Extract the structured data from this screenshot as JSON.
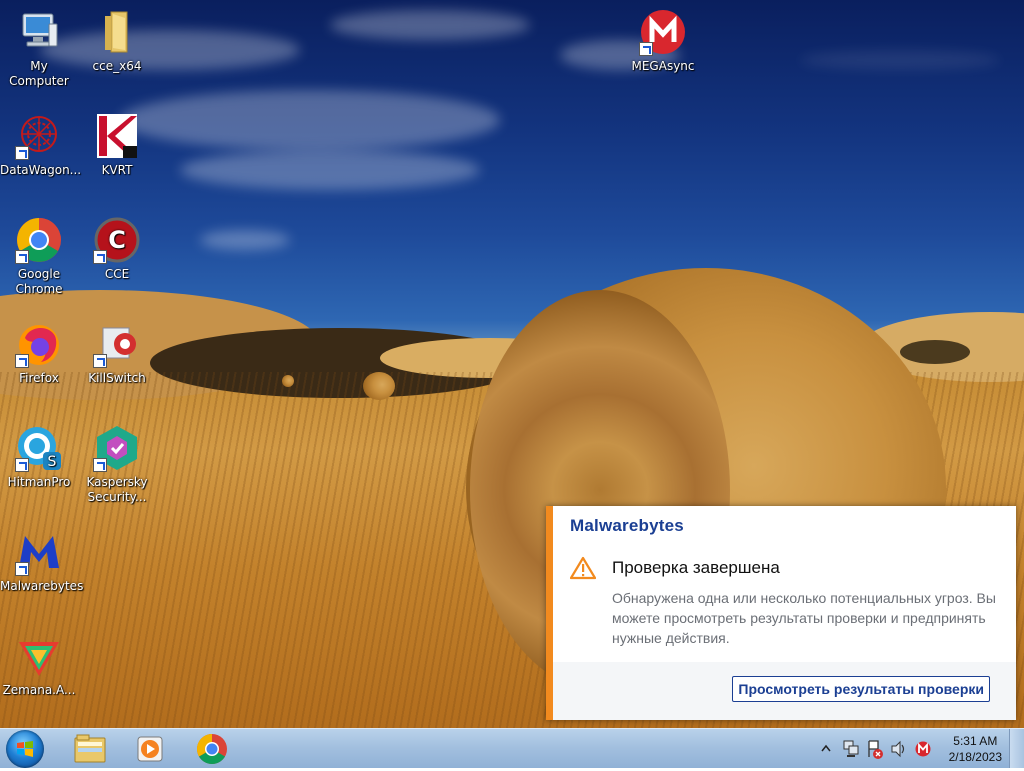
{
  "desktop": {
    "icons": [
      {
        "label": "My Computer",
        "icon": "computer-icon"
      },
      {
        "label": "cce_x64",
        "icon": "folder-icon"
      },
      {
        "label": "MEGAsync",
        "icon": "megasync-icon"
      },
      {
        "label": "DataWagon...",
        "icon": "datawagon-icon"
      },
      {
        "label": "KVRT",
        "icon": "kvrt-icon"
      },
      {
        "label": "Google Chrome",
        "icon": "chrome-icon"
      },
      {
        "label": "CCE",
        "icon": "cce-icon"
      },
      {
        "label": "Firefox",
        "icon": "firefox-icon"
      },
      {
        "label": "KillSwitch",
        "icon": "killswitch-icon"
      },
      {
        "label": "HitmanPro",
        "icon": "hitmanpro-icon"
      },
      {
        "label": "Kaspersky Security...",
        "icon": "kaspersky-icon"
      },
      {
        "label": "Malwarebytes",
        "icon": "malwarebytes-icon"
      },
      {
        "label": "Zemana.A...",
        "icon": "zemana-icon"
      }
    ]
  },
  "notification": {
    "brand": "Malwarebytes",
    "title": "Проверка завершена",
    "body": "Обнаружена одна или несколько потенциальных угроз. Вы можете просмотреть результаты проверки и предпринять нужные действия.",
    "action_label": "Просмотреть результаты проверки",
    "accent_color": "#f28a1e",
    "brand_color": "#1b3f93"
  },
  "taskbar": {
    "pinned": [
      {
        "name": "explorer",
        "icon": "folder-icon"
      },
      {
        "name": "media-player",
        "icon": "media-player-icon"
      },
      {
        "name": "chrome",
        "icon": "chrome-icon"
      }
    ],
    "tray": {
      "icons": [
        "show-hidden-icons-chevron",
        "network-icon",
        "action-center-icon",
        "volume-icon",
        "megasync-icon"
      ]
    },
    "clock": {
      "time": "5:31 AM",
      "date": "2/18/2023"
    }
  }
}
